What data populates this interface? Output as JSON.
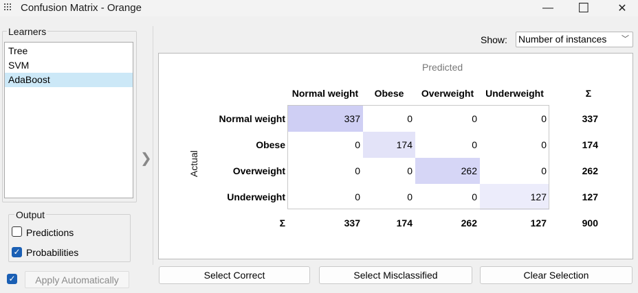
{
  "window": {
    "title": "Confusion Matrix - Orange",
    "minimize_glyph": "—",
    "maximize_glyph": "☐",
    "close_glyph": "✕"
  },
  "learners": {
    "title": "Learners",
    "items": [
      "Tree",
      "SVM",
      "AdaBoost"
    ],
    "selected": "AdaBoost"
  },
  "output": {
    "title": "Output",
    "predictions": {
      "label": "Predictions",
      "checked": false
    },
    "probabilities": {
      "label": "Probabilities",
      "checked": true
    }
  },
  "apply": {
    "label": "Apply Automatically",
    "checked": true
  },
  "show": {
    "label": "Show:",
    "value": "Number of instances"
  },
  "matrix": {
    "predicted_label": "Predicted",
    "actual_label": "Actual",
    "classes": [
      "Normal weight",
      "Obese",
      "Overweight",
      "Underweight"
    ],
    "sum_symbol": "Σ",
    "values": [
      [
        337,
        0,
        0,
        0
      ],
      [
        0,
        174,
        0,
        0
      ],
      [
        0,
        0,
        262,
        0
      ],
      [
        0,
        0,
        0,
        127
      ]
    ],
    "row_totals": [
      337,
      174,
      262,
      127
    ],
    "col_totals": [
      337,
      174,
      262,
      127
    ],
    "grand_total": 900,
    "highlight_colors": [
      "#cfcff4",
      "#e3e3f8",
      "#d6d6f6",
      "#ececfb"
    ]
  },
  "buttons": {
    "select_correct": "Select Correct",
    "select_misclassified": "Select Misclassified",
    "clear_selection": "Clear Selection"
  }
}
